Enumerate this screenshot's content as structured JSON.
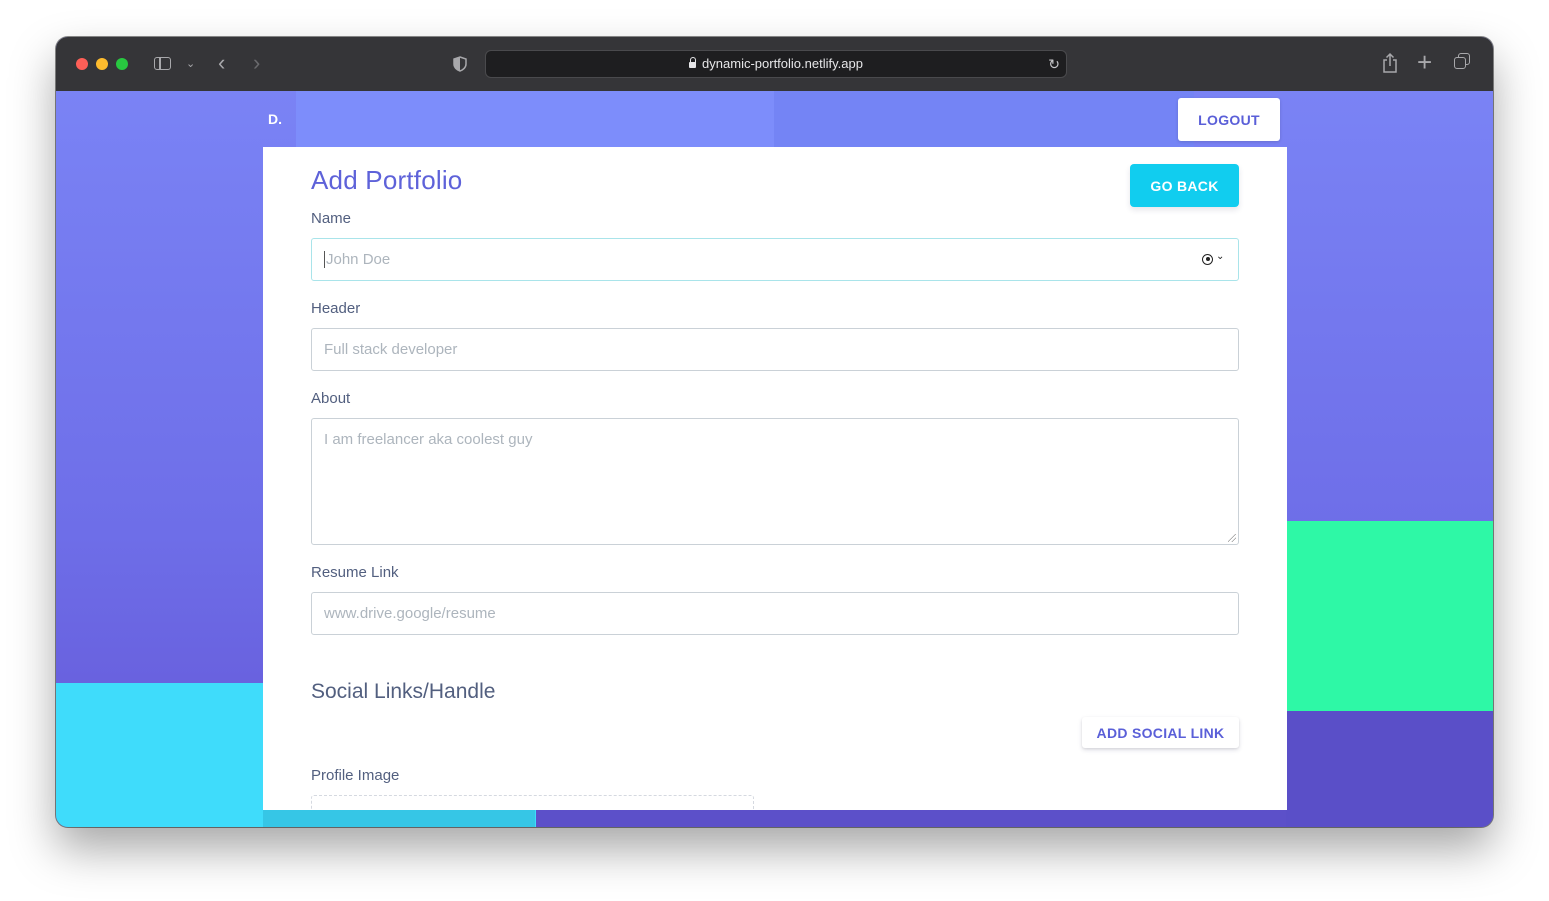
{
  "browser": {
    "url": "dynamic-portfolio.netlify.app"
  },
  "nav": {
    "brand": "D.",
    "logout_label": "LOGOUT"
  },
  "form": {
    "title": "Add Portfolio",
    "go_back_label": "GO BACK",
    "fields": {
      "name": {
        "label": "Name",
        "placeholder": "John Doe",
        "value": ""
      },
      "header": {
        "label": "Header",
        "placeholder": "Full stack developer",
        "value": ""
      },
      "about": {
        "label": "About",
        "placeholder": "I am freelancer aka coolest guy",
        "value": ""
      },
      "resume": {
        "label": "Resume Link",
        "placeholder": "www.drive.google/resume",
        "value": ""
      }
    },
    "social_section_title": "Social Links/Handle",
    "add_social_label": "ADD SOCIAL LINK",
    "profile_image_label": "Profile Image"
  },
  "colors": {
    "accent": "#5e62d9",
    "go_back_bg": "#11cdef",
    "cyan_block": "#3fdcfb",
    "green_block": "#2ef8a6"
  }
}
